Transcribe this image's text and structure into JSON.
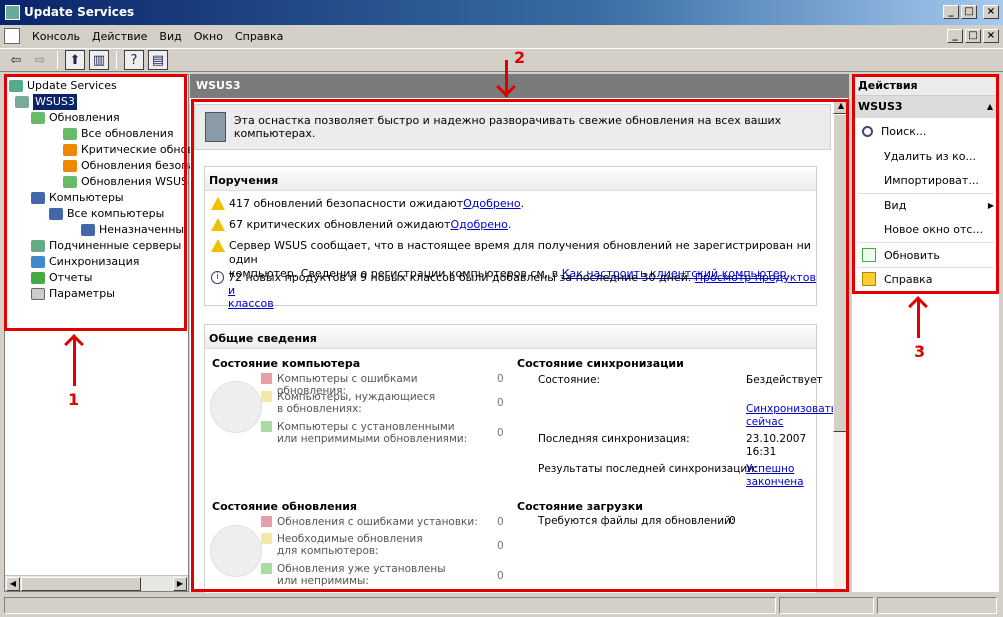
{
  "window": {
    "title": "Update Services",
    "min": "_",
    "max": "□",
    "close": "×"
  },
  "menu": [
    "Консоль",
    "Действие",
    "Вид",
    "Окно",
    "Справка"
  ],
  "tree": {
    "root": "Update Services",
    "server": "WSUS3",
    "updates": "Обновления",
    "all_updates": "Все обновления",
    "critical": "Критические обнов",
    "security": "Обновления безопа",
    "wsus_updates": "Обновления WSUS",
    "computers": "Компьютеры",
    "all_computers": "Все компьютеры",
    "unassigned": "Неназначенны",
    "downstream": "Подчиненные серверы",
    "sync": "Синхронизация",
    "reports": "Отчеты",
    "options": "Параметры"
  },
  "center": {
    "header": "WSUS3",
    "banner": "Эта оснастка позволяет быстро и надежно разворачивать свежие обновления на всех ваших компьютерах.",
    "tasks": {
      "title": "Поручения",
      "t1": "417 обновлений безопасности ожидают ",
      "t1_link": "Одобрено",
      "t2": "67 критических обновлений ожидают ",
      "t2_link": "Одобрено",
      "t3a": "Сервер WSUS сообщает, что в настоящее время для получения обновлений не зарегистрирован ни один",
      "t3b": "компьютер. Сведения о регистрации компьютеров см. в ",
      "t3_link": "Как настроить клиентский компьютер",
      "t4": "72 новых продуктов и 9 новых классов были добавлены за последние 30 дней. ",
      "t4_link1": "Просмотр продуктов и",
      "t4_link2": "классов",
      "dot": "."
    },
    "overview": {
      "title": "Общие сведения",
      "comp_status": "Состояние компьютера",
      "comp_legend": [
        {
          "label": "Компьютеры с ошибками обновления:",
          "count": "0",
          "color": "#e8a0a8"
        },
        {
          "label": "Компьютеры, нуждающиеся в обновлениях:",
          "count": "0",
          "color": "#f4e8a8"
        },
        {
          "label": "Компьютеры с установленными или непримимыми обновлениями:",
          "count": "0",
          "color": "#a8dca0"
        }
      ],
      "sync_status": "Состояние синхронизации",
      "state_label": "Состояние:",
      "state_value": "Бездействует",
      "sync_now": "Синхронизовать сейчас",
      "last_sync_label": "Последняя синхронизация:",
      "last_sync_value": "23.10.2007 16:31",
      "last_result_label": "Результаты последней синхронизации:",
      "last_result_value": "Успешно закончена",
      "update_status": "Состояние обновления",
      "upd_legend": [
        {
          "label": "Обновления с ошибками установки:",
          "count": "0",
          "color": "#e8a0a8"
        },
        {
          "label": "Необходимые обновления для компьютеров:",
          "count": "0",
          "color": "#f4e8a8"
        },
        {
          "label": "Обновления уже установлены или непримимы:",
          "count": "0",
          "color": "#a8dca0"
        }
      ],
      "download_status": "Состояние загрузки",
      "files_needed_label": "Требуются файлы для обновлений:",
      "files_needed_value": "0"
    }
  },
  "actions": {
    "title": "Действия",
    "section": "WSUS3",
    "items": [
      "Поиск...",
      "Удалить из ко...",
      "Импортироват...",
      "Вид",
      "Новое окно отс...",
      "Обновить",
      "Справка"
    ]
  },
  "annotations": [
    "1",
    "2",
    "3"
  ]
}
